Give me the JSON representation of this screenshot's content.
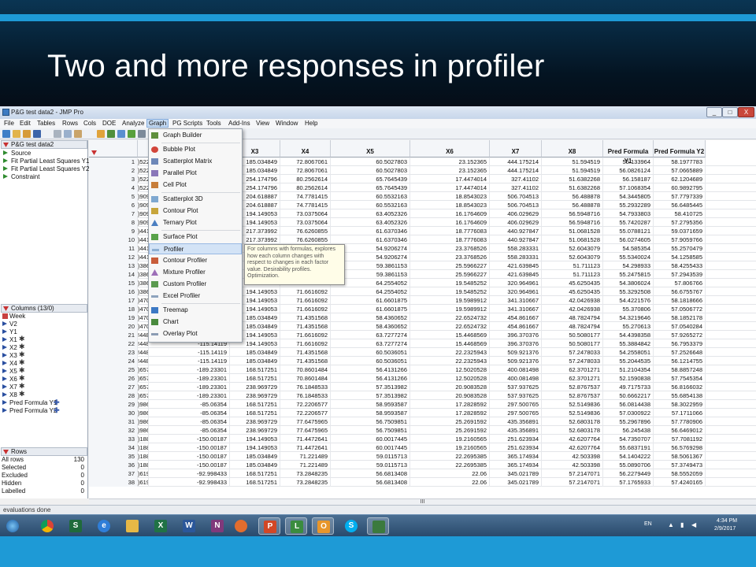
{
  "slide": {
    "title": "Two and more responses in profiler"
  },
  "window": {
    "title": "P&G test data2 - JMP Pro",
    "buttons": [
      "_",
      "□",
      "X"
    ]
  },
  "menubar": [
    "File",
    "Edit",
    "Tables",
    "Rows",
    "Cols",
    "DOE",
    "Analyze",
    "Graph",
    "PG Scripts",
    "Tools",
    "Add-Ins",
    "View",
    "Window",
    "Help"
  ],
  "left_panel": {
    "table_name": "P&G test data2",
    "scripts": [
      "Source",
      "Fit Partial Least Squares Y1",
      "Fit Partial Least Squares Y2",
      "Constraint"
    ],
    "columns_header": "Columns (13/0)",
    "columns": [
      "Week",
      "V2",
      "Y1",
      "X1",
      "X2",
      "X3",
      "X4",
      "X5",
      "X6",
      "X7",
      "X8",
      "Pred Formula Y1",
      "Pred Formula Y2"
    ],
    "rows_header": "Rows",
    "rows": [
      {
        "label": "All rows",
        "value": "130"
      },
      {
        "label": "Selected",
        "value": "0"
      },
      {
        "label": "Excluded",
        "value": "0"
      },
      {
        "label": "Hidden",
        "value": "0"
      },
      {
        "label": "Labelled",
        "value": "0"
      }
    ]
  },
  "graph_menu": {
    "items": [
      "Graph Builder",
      "Bubble Plot",
      "Scatterplot Matrix",
      "Parallel Plot",
      "Cell Plot",
      "Scatterplot 3D",
      "Contour Plot",
      "Ternary Plot",
      "Surface Plot",
      "Profiler",
      "Contour Profiler",
      "Mixture Profiler",
      "Custom Profiler",
      "Excel Profiler",
      "Treemap",
      "Chart",
      "Overlay Plot"
    ],
    "highlighted": "Profiler",
    "tooltip": "For columns with formulas, explores how each column changes with respect to changes in each factor value. Desirability profiles. Optimization."
  },
  "table": {
    "headers": [
      "X3",
      "X4",
      "X5",
      "X6",
      "X7",
      "X8",
      "Pred Formula Y1",
      "Pred Formula Y2"
    ],
    "rows": [
      {
        "n": "1",
        "x1": ")522",
        "x2": "",
        "x3": "185.034849",
        "x4": "72.8067061",
        "x5": "60.5027803",
        "x6": "23.152365",
        "x7": "444.175214",
        "x8": "51.594519",
        "p1": "55.133964",
        "p2": "58.1977783"
      },
      {
        "n": "2",
        "x1": ")522",
        "x2": "",
        "x3": "185.034849",
        "x4": "72.8067061",
        "x5": "60.5027803",
        "x6": "23.152365",
        "x7": "444.175214",
        "x8": "51.594519",
        "p1": "56.0826124",
        "p2": "57.0665889"
      },
      {
        "n": "3",
        "x1": ")522",
        "x2": "",
        "x3": "254.174796",
        "x4": "80.2562614",
        "x5": "65.7645439",
        "x6": "17.4474014",
        "x7": "327.41102",
        "x8": "51.6382268",
        "p1": "56.158187",
        "p2": "62.1204689"
      },
      {
        "n": "4",
        "x1": ")522",
        "x2": "",
        "x3": "254.174796",
        "x4": "80.2562614",
        "x5": "65.7645439",
        "x6": "17.4474014",
        "x7": "327.41102",
        "x8": "51.6382268",
        "p1": "57.1068354",
        "p2": "60.9892795"
      },
      {
        "n": "5",
        "x1": ")909",
        "x2": "",
        "x3": "204.618887",
        "x4": "74.7781415",
        "x5": "60.5532163",
        "x6": "18.8543023",
        "x7": "506.704513",
        "x8": "56.488878",
        "p1": "54.3445805",
        "p2": "57.7797339"
      },
      {
        "n": "6",
        "x1": ")909",
        "x2": "",
        "x3": "204.618887",
        "x4": "74.7781415",
        "x5": "60.5532163",
        "x6": "18.8543023",
        "x7": "506.704513",
        "x8": "56.488878",
        "p1": "55.2932289",
        "p2": "56.6485445"
      },
      {
        "n": "7",
        "x1": ")909",
        "x2": "",
        "x3": "194.149053",
        "x4": "73.0375064",
        "x5": "63.4052326",
        "x6": "16.1764609",
        "x7": "406.029629",
        "x8": "56.5948716",
        "p1": "54.7933803",
        "p2": "58.410725"
      },
      {
        "n": "8",
        "x1": ")909",
        "x2": "",
        "x3": "194.149053",
        "x4": "73.0375064",
        "x5": "63.4052326",
        "x6": "16.1764609",
        "x7": "406.029629",
        "x8": "56.5948716",
        "p1": "55.7420287",
        "p2": "57.2795356"
      },
      {
        "n": "9",
        "x1": ")441",
        "x2": "",
        "x3": "217.373992",
        "x4": "76.6260855",
        "x5": "61.6370346",
        "x6": "18.7776083",
        "x7": "440.927847",
        "x8": "51.0681528",
        "p1": "55.0788121",
        "p2": "59.0371659"
      },
      {
        "n": "10",
        "x1": ")441",
        "x2": "",
        "x3": "217.373992",
        "x4": "76.6260855",
        "x5": "61.6370346",
        "x6": "18.7776083",
        "x7": "440.927847",
        "x8": "51.0681528",
        "p1": "56.0274605",
        "p2": "57.9059766"
      },
      {
        "n": "11",
        "x1": ")441",
        "x2": "",
        "x3": "",
        "x4": "",
        "x5": "54.9206274",
        "x6": "23.3768526",
        "x7": "558.283331",
        "x8": "52.6043079",
        "p1": "54.585354",
        "p2": "55.2570479"
      },
      {
        "n": "12",
        "x1": ")441",
        "x2": "",
        "x3": "",
        "x4": "",
        "x5": "54.9206274",
        "x6": "23.3768526",
        "x7": "558.283331",
        "x8": "52.6043079",
        "p1": "55.5340024",
        "p2": "54.1258585"
      },
      {
        "n": "13",
        "x1": ")386",
        "x2": "",
        "x3": "",
        "x4": "",
        "x5": "59.3861153",
        "x6": "25.5966227",
        "x7": "421.639845",
        "x8": "51.711123",
        "p1": "54.298933",
        "p2": "58.4255433"
      },
      {
        "n": "14",
        "x1": ")386",
        "x2": "",
        "x3": "",
        "x4": "",
        "x5": "59.3861153",
        "x6": "25.5966227",
        "x7": "421.639845",
        "x8": "51.711123",
        "p1": "55.2475815",
        "p2": "57.2943539"
      },
      {
        "n": "15",
        "x1": ")386",
        "x2": "",
        "x3": "",
        "x4": "",
        "x5": "64.2554052",
        "x6": "19.5485252",
        "x7": "320.964961",
        "x8": "45.6250435",
        "p1": "54.3806024",
        "p2": "57.806766"
      },
      {
        "n": "16",
        "x1": ")386",
        "x2": "",
        "x3": "194.149053",
        "x4": "71.6616092",
        "x5": "64.2554052",
        "x6": "19.5485252",
        "x7": "320.964961",
        "x8": "45.6250435",
        "p1": "55.3292508",
        "p2": "56.6755767"
      },
      {
        "n": "17",
        "x1": ")470",
        "x2": "",
        "x3": "194.149053",
        "x4": "71.6616092",
        "x5": "61.6601875",
        "x6": "19.5989912",
        "x7": "341.310667",
        "x8": "42.0426938",
        "p1": "54.4221576",
        "p2": "58.1818666"
      },
      {
        "n": "18",
        "x1": ")470",
        "x2": "",
        "x3": "194.149053",
        "x4": "71.6616092",
        "x5": "61.6601875",
        "x6": "19.5989912",
        "x7": "341.310667",
        "x8": "42.0426938",
        "p1": "55.370806",
        "p2": "57.0506772"
      },
      {
        "n": "19",
        "x1": ")470",
        "x2": "",
        "x3": "185.034849",
        "x4": "71.4351568",
        "x5": "58.4360652",
        "x6": "22.6524732",
        "x7": "454.861667",
        "x8": "48.7824794",
        "p1": "54.3219646",
        "p2": "58.1852178"
      },
      {
        "n": "20",
        "x1": ")470",
        "x2": "",
        "x3": "185.034849",
        "x4": "71.4351568",
        "x5": "58.4360652",
        "x6": "22.6524732",
        "x7": "454.861667",
        "x8": "48.7824794",
        "p1": "55.270613",
        "p2": "57.0540284"
      },
      {
        "n": "21",
        "x1": "!4489",
        "x2": "-115.14119",
        "x3": "194.149053",
        "x4": "71.6616092",
        "x5": "63.7277274",
        "x6": "15.4468569",
        "x7": "396.370376",
        "x8": "50.5080177",
        "p1": "54.4398358",
        "p2": "57.9265272"
      },
      {
        "n": "22",
        "x1": "!4489",
        "x2": "-115.14119",
        "x3": "194.149053",
        "x4": "71.6616092",
        "x5": "63.7277274",
        "x6": "15.4468569",
        "x7": "396.370376",
        "x8": "50.5080177",
        "p1": "55.3884842",
        "p2": "56.7953379"
      },
      {
        "n": "23",
        "x1": "!4489",
        "x2": "-115.14119",
        "x3": "185.034849",
        "x4": "71.4351568",
        "x5": "60.5036051",
        "x6": "22.2325943",
        "x7": "509.921376",
        "x8": "57.2478033",
        "p1": "54.2558051",
        "p2": "57.2526648"
      },
      {
        "n": "24",
        "x1": "!4489",
        "x2": "-115.14119",
        "x3": "185.034849",
        "x4": "71.4351568",
        "x5": "60.5036051",
        "x6": "22.2325943",
        "x7": "509.921376",
        "x8": "57.2478033",
        "p1": "55.2044535",
        "p2": "56.1214755"
      },
      {
        "n": "25",
        "x1": ")6576",
        "x2": "-189.23301",
        "x3": "168.517251",
        "x4": "70.8601484",
        "x5": "56.4131266",
        "x6": "12.5020528",
        "x7": "400.081498",
        "x8": "62.3701271",
        "p1": "51.2104354",
        "p2": "58.8857248"
      },
      {
        "n": "26",
        "x1": ")6576",
        "x2": "-189.23301",
        "x3": "168.517251",
        "x4": "70.8601484",
        "x5": "56.4131266",
        "x6": "12.5020528",
        "x7": "400.081498",
        "x8": "62.3701271",
        "p1": "52.1590838",
        "p2": "57.7545354"
      },
      {
        "n": "27",
        "x1": ")6576",
        "x2": "-189.23301",
        "x3": "238.969729",
        "x4": "76.1848533",
        "x5": "57.3513982",
        "x6": "20.9083528",
        "x7": "537.937625",
        "x8": "52.8767537",
        "p1": "49.7175733",
        "p2": "56.8166032"
      },
      {
        "n": "28",
        "x1": ")6576",
        "x2": "-189.23301",
        "x3": "238.969729",
        "x4": "76.1848533",
        "x5": "57.3513982",
        "x6": "20.9083528",
        "x7": "537.937625",
        "x8": "52.8767537",
        "p1": "50.6662217",
        "p2": "55.6854138"
      },
      {
        "n": "29",
        "x1": ")9864",
        "x2": "-85.06354",
        "x3": "168.517251",
        "x4": "72.2206577",
        "x5": "58.9593587",
        "x6": "17.2828592",
        "x7": "297.500765",
        "x8": "52.5149836",
        "p1": "56.0814438",
        "p2": "58.3022959"
      },
      {
        "n": "30",
        "x1": ")9864",
        "x2": "-85.06354",
        "x3": "168.517251",
        "x4": "72.2206577",
        "x5": "58.9593587",
        "x6": "17.2828592",
        "x7": "297.500765",
        "x8": "52.5149836",
        "p1": "57.0300922",
        "p2": "57.1711066"
      },
      {
        "n": "31",
        "x1": ")9864",
        "x2": "-85.06354",
        "x3": "238.969729",
        "x4": "77.6475965",
        "x5": "56.7509851",
        "x6": "25.2691592",
        "x7": "435.356891",
        "x8": "52.6803178",
        "p1": "55.2967896",
        "p2": "57.7780906"
      },
      {
        "n": "32",
        "x1": ")9864",
        "x2": "-85.06354",
        "x3": "238.969729",
        "x4": "77.6475965",
        "x5": "56.7509851",
        "x6": "25.2691592",
        "x7": "435.356891",
        "x8": "52.6803178",
        "p1": "56.245438",
        "p2": "56.6469012"
      },
      {
        "n": "33",
        "x1": ")1887",
        "x2": "-150.00187",
        "x3": "194.149053",
        "x4": "71.4472641",
        "x5": "60.0017445",
        "x6": "19.2160565",
        "x7": "251.623934",
        "x8": "42.6207764",
        "p1": "54.7350707",
        "p2": "57.7081192"
      },
      {
        "n": "34",
        "x1": ")1887",
        "x2": "-150.00187",
        "x3": "194.149053",
        "x4": "71.4472641",
        "x5": "60.0017445",
        "x6": "19.2160565",
        "x7": "251.623934",
        "x8": "42.6207764",
        "p1": "55.6837191",
        "p2": "56.5769298"
      },
      {
        "n": "35",
        "x1": ")1887",
        "x2": "-150.00187",
        "x3": "185.034849",
        "x4": "71.221489",
        "x5": "59.0115713",
        "x6": "22.2695385",
        "x7": "365.174934",
        "x8": "42.503398",
        "p1": "54.1404222",
        "p2": "58.5061367"
      },
      {
        "n": "36",
        "x1": ")1887",
        "x2": "-150.00187",
        "x3": "185.034849",
        "x4": "71.221489",
        "x5": "59.0115713",
        "x6": "22.2695385",
        "x7": "365.174934",
        "x8": "42.503398",
        "p1": "55.0890706",
        "p2": "57.3749473"
      },
      {
        "n": "37",
        "x1": ")6198",
        "x2": "-92.998433",
        "x3": "168.517251",
        "x4": "73.2848235",
        "x5": "56.6813408",
        "x6": "22.06",
        "x7": "345.021789",
        "x8": "57.2147071",
        "p1": "56.2279449",
        "p2": "58.5552059"
      },
      {
        "n": "38",
        "x1": ")6198",
        "x2": "-92.998433",
        "x3": "168.517251",
        "x4": "73.2848235",
        "x5": "56.6813408",
        "x6": "22.06",
        "x7": "345.021789",
        "x8": "57.2147071",
        "p1": "57.1765933",
        "p2": "57.4240165"
      }
    ]
  },
  "status": "evaluations done",
  "hscroll_label": "III",
  "taskbar": {
    "lang": "EN",
    "time": "4:34 PM",
    "date": "2/9/2017"
  }
}
